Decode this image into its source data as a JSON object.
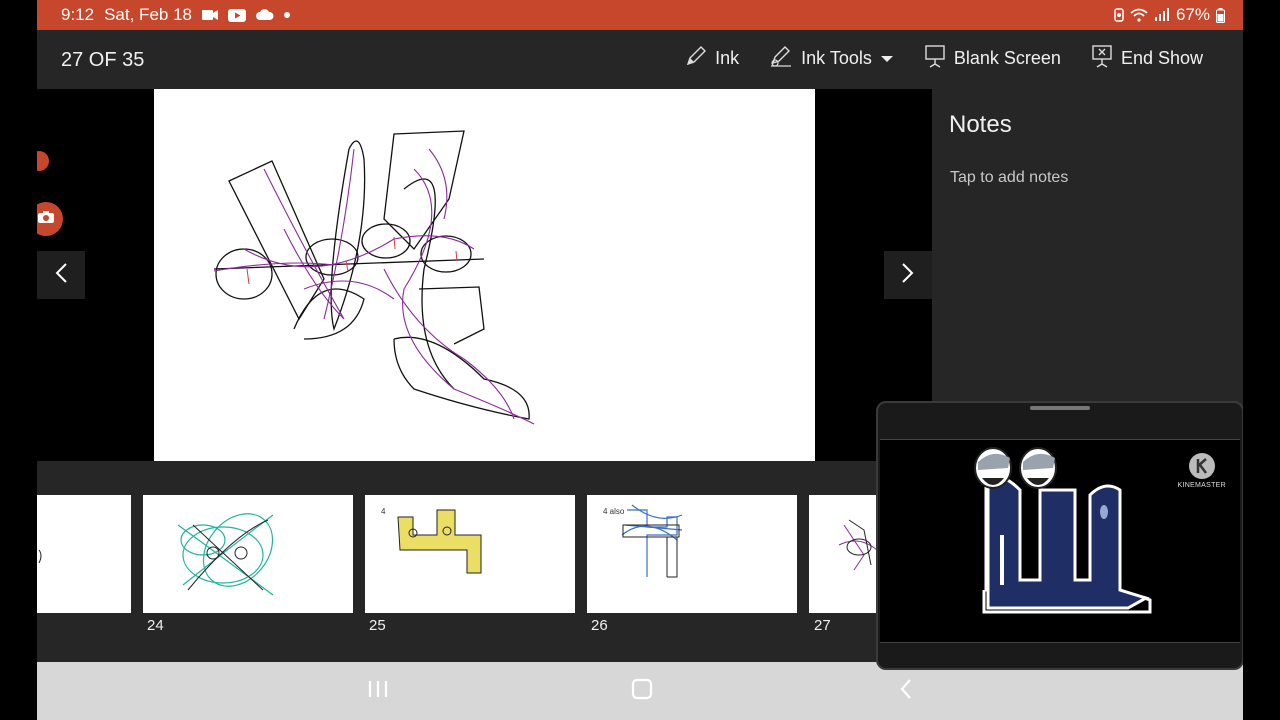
{
  "status_bar": {
    "time": "9:12",
    "date": "Sat, Feb 18",
    "battery": "67%"
  },
  "toolbar": {
    "slide_counter": "27 OF 35",
    "ink_label": "Ink",
    "ink_tools_label": "Ink Tools",
    "blank_screen_label": "Blank Screen",
    "end_show_label": "End Show"
  },
  "notes": {
    "title": "Notes",
    "placeholder": "Tap to add notes"
  },
  "thumbnails": [
    {
      "number": "",
      "text": ""
    },
    {
      "number": "24",
      "text": ""
    },
    {
      "number": "25",
      "text": "4"
    },
    {
      "number": "26",
      "text": "4 also"
    },
    {
      "number": "27",
      "text": ""
    }
  ],
  "pip": {
    "logo_text": "KINEMASTER"
  },
  "colors": {
    "status_bar": "#c6472b",
    "toolbar": "#262626",
    "nav_bar": "#d7d7d7",
    "ink_purple": "#8a2a9a",
    "ink_teal": "#1fb5a0",
    "ink_yellow": "#e6d84a",
    "ink_blue": "#3b6fc6",
    "character_navy": "#1f2f66"
  },
  "icons": [
    "youtube-icon",
    "cloud-icon",
    "wifi-icon",
    "signal-icon",
    "battery-icon",
    "pencil-icon",
    "ink-tools-icon",
    "blank-screen-icon",
    "end-show-icon",
    "chevron-left-icon",
    "chevron-right-icon",
    "camera-icon",
    "recents-icon",
    "home-icon",
    "back-icon"
  ]
}
